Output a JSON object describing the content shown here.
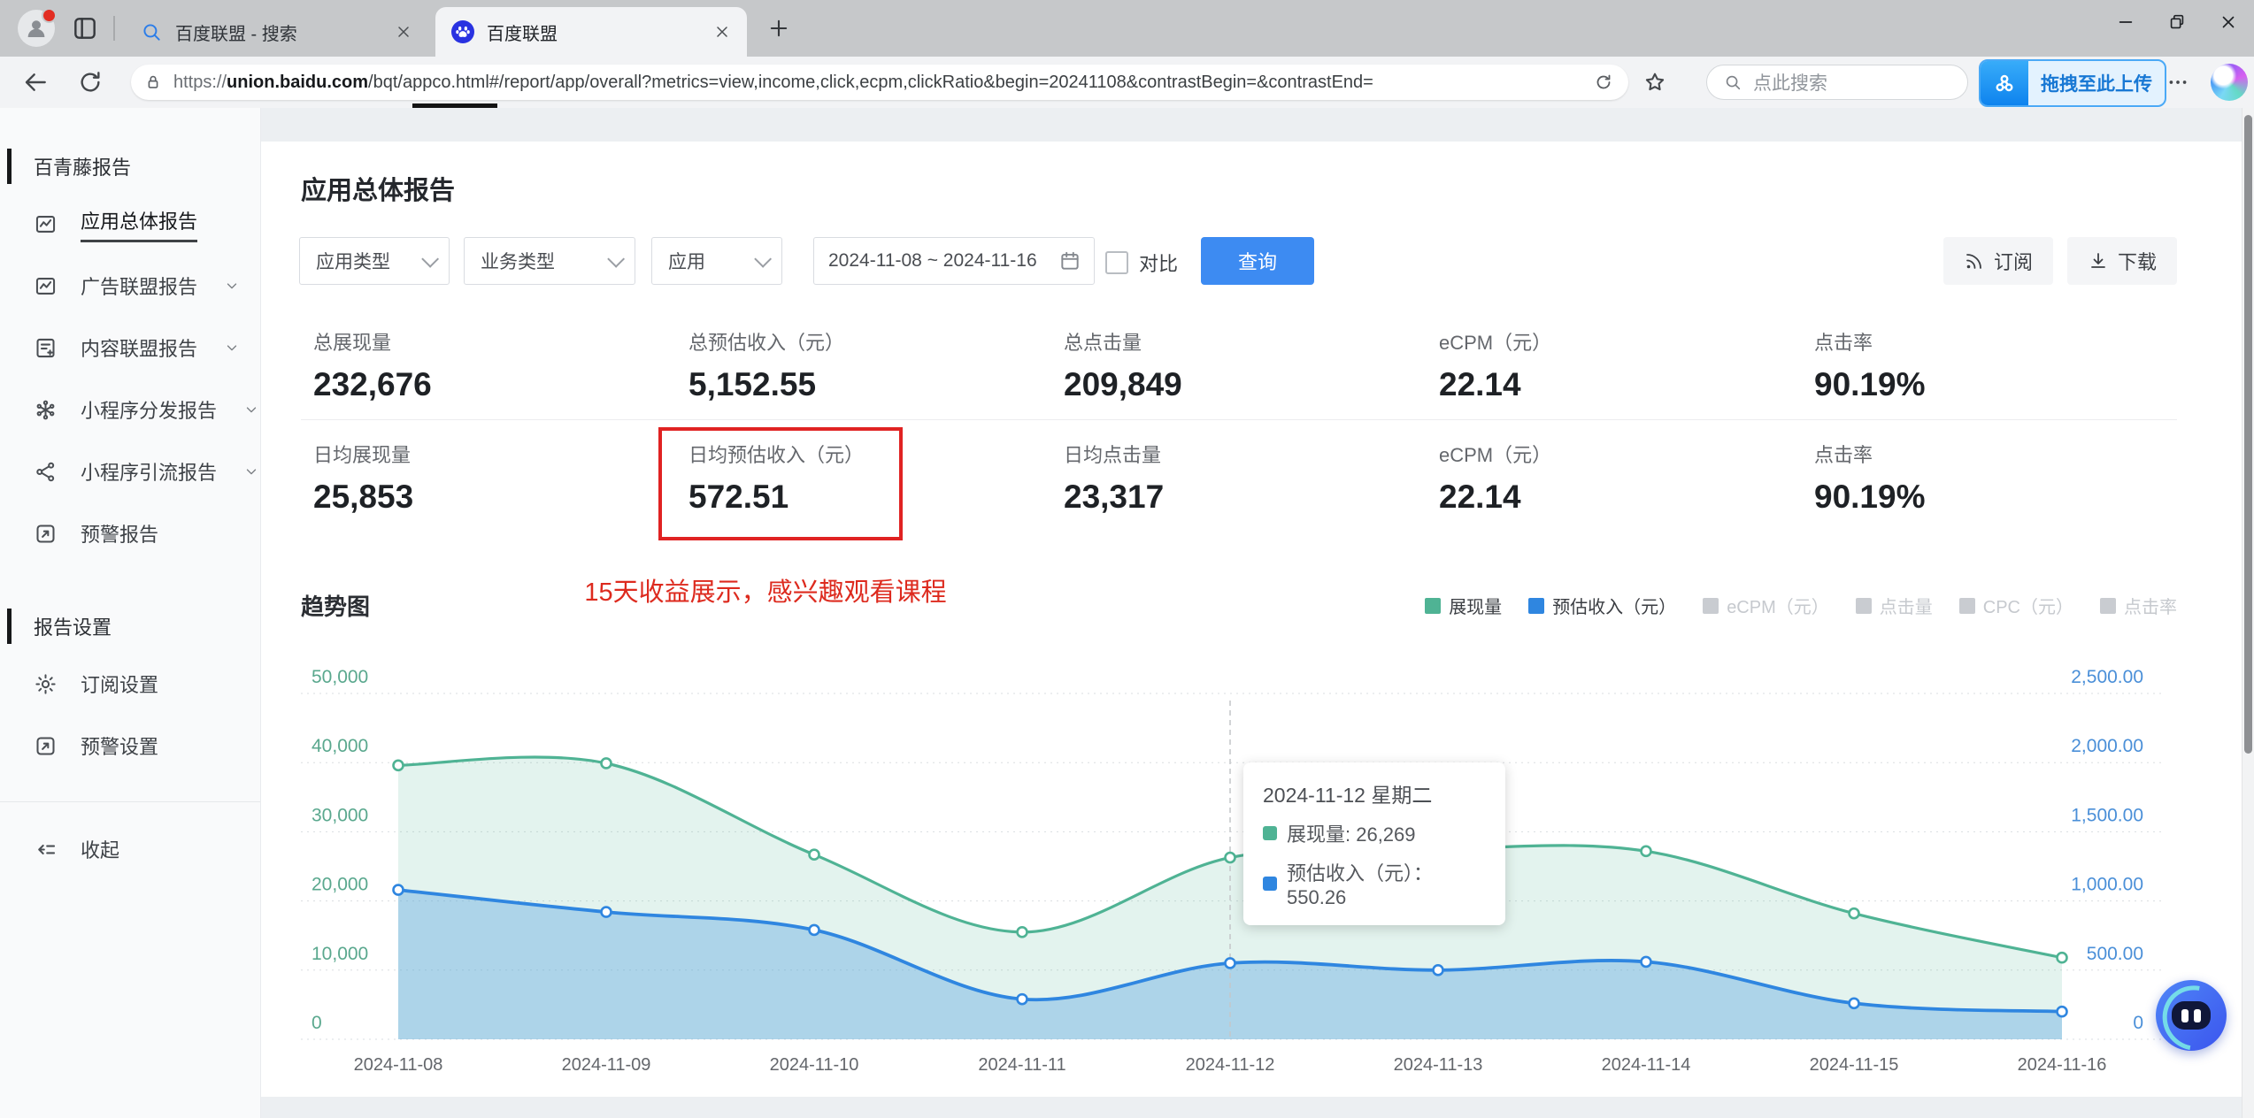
{
  "browser": {
    "tabs": [
      {
        "title": "百度联盟 - 搜索",
        "icon": "search-favicon",
        "active": false
      },
      {
        "title": "百度联盟",
        "icon": "baidu-favicon",
        "active": true
      }
    ],
    "url": {
      "protocol": "https://",
      "domain": "union.baidu.com",
      "path": "/bqt/appco.html#/report/app/overall?metrics=view,income,click,ecpm,clickRatio&begin=20241108&contrastBegin=&contrastEnd="
    },
    "search_placeholder": "点此搜索",
    "upload_label": "拖拽至此上传"
  },
  "sidebar": {
    "sections": [
      {
        "header": "百青藤报告",
        "items": [
          {
            "key": "app-overall-report",
            "label": "应用总体报告",
            "icon": "report",
            "active": true,
            "expandable": false
          },
          {
            "key": "ad-union-report",
            "label": "广告联盟报告",
            "icon": "report",
            "expandable": true
          },
          {
            "key": "content-union-report",
            "label": "内容联盟报告",
            "icon": "content-report",
            "expandable": true
          },
          {
            "key": "mini-program-distribution-report",
            "label": "小程序分发报告",
            "icon": "distribute",
            "expandable": true
          },
          {
            "key": "mini-program-referral-report",
            "label": "小程序引流报告",
            "icon": "share",
            "expandable": true
          },
          {
            "key": "alert-report",
            "label": "预警报告",
            "icon": "alert",
            "expandable": false
          }
        ]
      },
      {
        "header": "报告设置",
        "items": [
          {
            "key": "subscription-settings",
            "label": "订阅设置",
            "icon": "gear",
            "expandable": false
          },
          {
            "key": "alert-settings",
            "label": "预警设置",
            "icon": "alert",
            "expandable": false
          }
        ]
      }
    ],
    "collapse_label": "收起"
  },
  "main": {
    "page_title": "应用总体报告",
    "filters": {
      "selects": [
        "应用类型",
        "业务类型",
        "应用"
      ],
      "date_range": "2024-11-08 ~ 2024-11-16",
      "compare_label": "对比",
      "query_label": "查询"
    },
    "toolbar": {
      "subscribe_label": "订阅",
      "download_label": "下载"
    },
    "stats": [
      [
        {
          "label": "总展现量",
          "value": "232,676"
        },
        {
          "label": "总预估收入（元）",
          "value": "5,152.55"
        },
        {
          "label": "总点击量",
          "value": "209,849"
        },
        {
          "label": "eCPM（元）",
          "value": "22.14"
        },
        {
          "label": "点击率",
          "value": "90.19%"
        }
      ],
      [
        {
          "label": "日均展现量",
          "value": "25,853"
        },
        {
          "label": "日均预估收入（元）",
          "value": "572.51",
          "highlighted": true
        },
        {
          "label": "日均点击量",
          "value": "23,317"
        },
        {
          "label": "eCPM（元）",
          "value": "22.14"
        },
        {
          "label": "点击率",
          "value": "90.19%"
        }
      ]
    ],
    "annotation": "15天收益展示，感兴趣观看课程",
    "chart_title": "趋势图"
  },
  "chart_data": {
    "type": "area",
    "x": [
      "2024-11-08",
      "2024-11-09",
      "2024-11-10",
      "2024-11-11",
      "2024-11-12",
      "2024-11-13",
      "2024-11-14",
      "2024-11-15",
      "2024-11-16"
    ],
    "series": [
      {
        "name": "展现量",
        "axis": "left",
        "color": "#4fb394",
        "fill": "rgba(79,179,148,0.16)",
        "width": 3.2,
        "values": [
          39600,
          39900,
          26700,
          15500,
          26269,
          27500,
          27200,
          18200,
          11800
        ]
      },
      {
        "name": "预估收入（元）",
        "axis": "right",
        "color": "#2f86e0",
        "fill": "rgba(98,169,226,0.42)",
        "width": 3.8,
        "values": [
          1080,
          920,
          790,
          290,
          550.26,
          500,
          560,
          260,
          200
        ]
      }
    ],
    "legend": [
      {
        "label": "展现量",
        "color": "#4fb394",
        "enabled": true
      },
      {
        "label": "预估收入（元）",
        "color": "#2f86e0",
        "enabled": true
      },
      {
        "label": "eCPM（元）",
        "color": "#c9ccd1",
        "enabled": false
      },
      {
        "label": "点击量",
        "color": "#c9ccd1",
        "enabled": false
      },
      {
        "label": "CPC（元）",
        "color": "#c9ccd1",
        "enabled": false
      },
      {
        "label": "点击率",
        "color": "#c9ccd1",
        "enabled": false
      }
    ],
    "left_axis": {
      "min": 0,
      "max": 50000,
      "ticks": [
        "0",
        "10,000",
        "20,000",
        "30,000",
        "40,000",
        "50,000"
      ]
    },
    "right_axis": {
      "min": 0,
      "max": 2500,
      "ticks": [
        "0",
        "500.00",
        "1,000.00",
        "1,500.00",
        "2,000.00",
        "2,500.00"
      ]
    },
    "tooltip": {
      "title": "2024-11-12 星期二",
      "x_index": 4,
      "rows": [
        {
          "text": "展现量: 26,269",
          "color": "#4fb394"
        },
        {
          "text": "预估收入（元）：550.26",
          "color": "#2f86e0"
        }
      ]
    },
    "grid": true,
    "legend_position": "top-right"
  }
}
